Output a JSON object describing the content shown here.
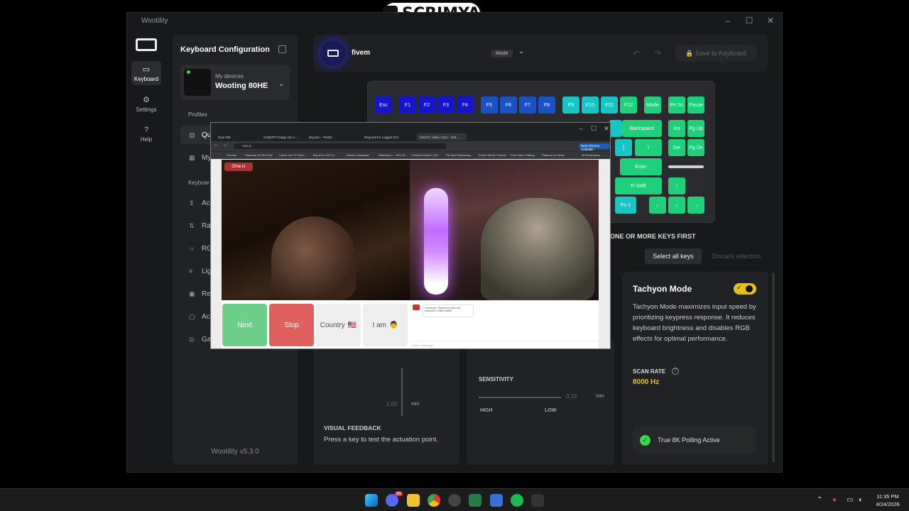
{
  "overlay": {
    "text": "SCRIMYA",
    "icon": "twitch-icon"
  },
  "window": {
    "title": "Wootility",
    "controls": {
      "min": "–",
      "max": "☐",
      "close": "✕"
    }
  },
  "nav": [
    {
      "label": "Keyboard",
      "icon": "keyboard-icon",
      "active": true
    },
    {
      "label": "Settings",
      "icon": "gear-icon"
    },
    {
      "label": "Help",
      "icon": "help-icon"
    }
  ],
  "sidebar": {
    "title": "Keyboard Configuration",
    "device": {
      "label": "My devices",
      "name": "Wooting 80HE"
    },
    "profiles_label": "Profiles",
    "profiles": [
      "Qu",
      "My"
    ],
    "keyboard_label": "Keyboar",
    "items": [
      "Ac",
      "Ra",
      "RG",
      "Lig",
      "Re",
      "Ac",
      "Ga"
    ],
    "version": "Wootility v5.3.0"
  },
  "header": {
    "profile": "fivem",
    "mode": "Mode",
    "save": "Save to Keyboard"
  },
  "keyboard": {
    "row1": [
      "Esc",
      "F1",
      "F2",
      "F3",
      "F4",
      "F5",
      "F6",
      "F7",
      "F8",
      "F9",
      "F10",
      "F11",
      "F12",
      "Mode",
      "Prt Sc",
      "Pause"
    ],
    "right": [
      "Backspace",
      "Ins",
      "Pg Up",
      "]",
      "\\",
      "Del",
      "Pg Dn",
      "Enter",
      "R-Shift",
      "↑",
      "Fn 1",
      "←",
      "↓",
      "→"
    ]
  },
  "selection": {
    "hint": "ONE OR MORE KEYS FIRST",
    "select_all": "Select all keys",
    "discard": "Discard selection"
  },
  "tachyon": {
    "title": "Tachyon Mode",
    "enabled": true,
    "description": "Tachyon Mode maximizes input speed by prioritizing keypress response. It reduces keyboard brightness and disables RGB effects for optimal performance.",
    "scan_rate_label": "SCAN RATE",
    "scan_rate_value": "8000 Hz",
    "polling": "True 8K Polling Active"
  },
  "lower": {
    "visual_feedback_title": "VISUAL FEEDBACK",
    "visual_feedback_text": "Press a key to test the actuation point.",
    "actuation_value": "1.00",
    "unit": "mm",
    "sensitivity": "SENSITIVITY",
    "sens_value": "0.15",
    "high": "HIGH",
    "low": "LOW"
  },
  "browser": {
    "tabs": [
      "New Tab",
      "ChatGPT Image Apr 2...",
      "Digi.tav – Twitch",
      "Request for Logged Out",
      "OmeTV Video Chat – Onl..."
    ],
    "url": "ome.tv",
    "update": "New Chrome available",
    "bookmarks": [
      "Chrome",
      "Students GH Mol-Tub",
      "Check out 137 Intel...",
      "Bhp'in to 240 Co...",
      "Callsh's Heatwave",
      "Standard p – Slim Ht...",
      "Cartland Market | 1ld...",
      "The Best Streaming...",
      "TurboV Medio Product",
      "Free Video Editing...",
      "Patterns by Study",
      "All Bookmarks"
    ],
    "ometv": "Ome.tv",
    "buttons": {
      "next": "Next",
      "stop": "Stop",
      "country": "Country",
      "country_flag": "🇺🇸",
      "iam": "I am",
      "iam_emoji": "👨"
    },
    "chat_msg": "Connected. Please be polite and respectful. United States",
    "chat_placeholder": "Write a message"
  },
  "taskbar": {
    "time": "11:35 PM",
    "date": "4/24/2026",
    "badge": "99"
  }
}
